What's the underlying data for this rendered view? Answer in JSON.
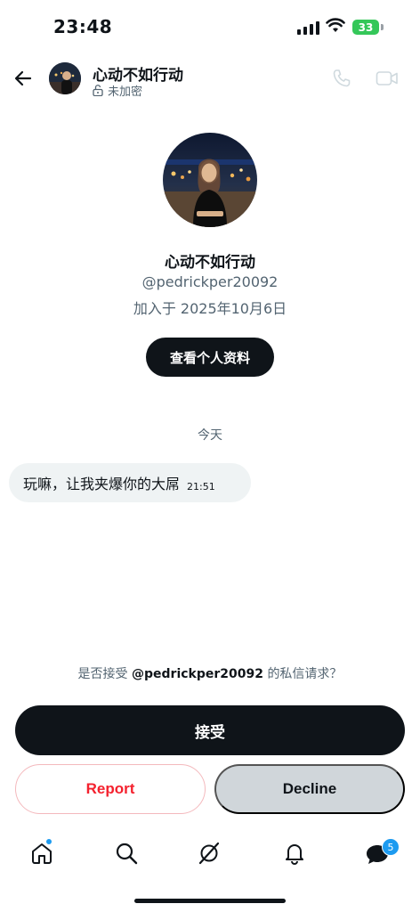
{
  "status_bar": {
    "time": "23:48",
    "battery": "33"
  },
  "header": {
    "name": "心动不如行动",
    "encryption": "未加密",
    "back_icon": "arrow-left-icon",
    "call_icon": "phone-icon",
    "video_icon": "video-icon"
  },
  "profile": {
    "name": "心动不如行动",
    "handle": "@pedrickper20092",
    "joined": "加入于 2025年10月6日",
    "view_button": "查看个人资料"
  },
  "chat": {
    "day_label": "今天",
    "messages": [
      {
        "text": "玩嘛，让我夹爆你的大屌",
        "time": "21:51"
      }
    ]
  },
  "request": {
    "prefix": "是否接受",
    "handle": "@pedrickper20092",
    "suffix": "的私信请求？"
  },
  "actions": {
    "accept": "接受",
    "report": "Report",
    "decline": "Decline"
  },
  "bottom_nav": {
    "items": [
      "home-icon",
      "search-icon",
      "grok-icon",
      "notifications-icon",
      "messages-icon"
    ],
    "messages_badge": "5"
  },
  "colors": {
    "accent": "#1d9bf0",
    "dark": "#0f1419",
    "danger": "#f4212e",
    "battery": "#34c759"
  }
}
